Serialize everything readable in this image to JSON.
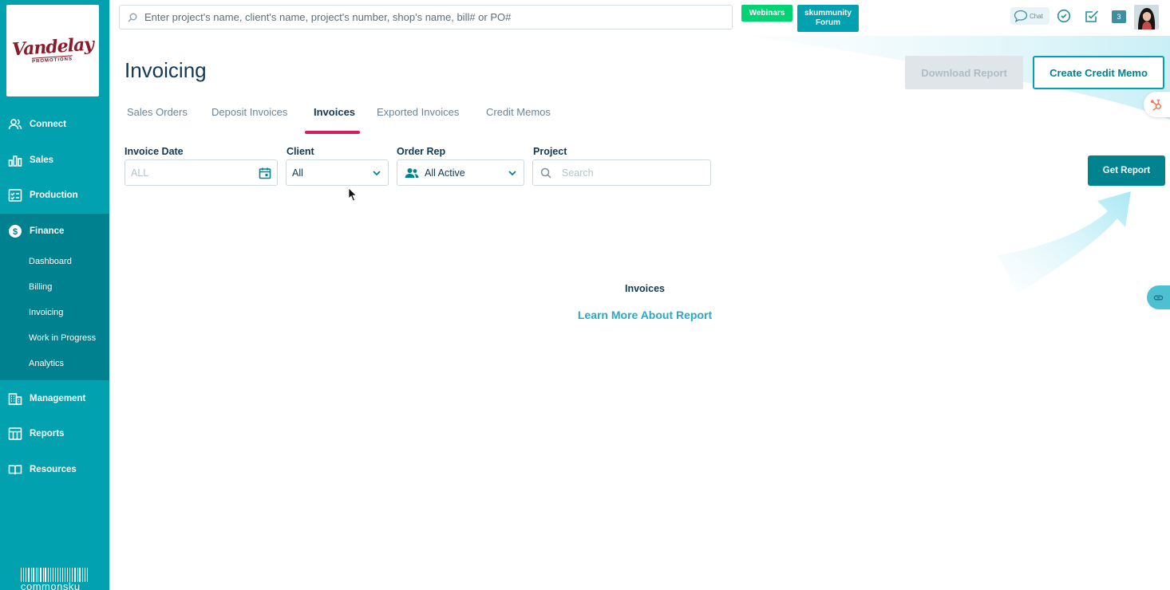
{
  "brand": {
    "logo_main": "Vandelay",
    "logo_sub": "PROMOTIONS",
    "footer_logo": "commonsku"
  },
  "topbar": {
    "search_placeholder": "Enter project's name, client's name, project's number, shop's name, bill# or PO#",
    "webinars_label": "Webinars",
    "forum_line1": "skummunity",
    "forum_line2": "Forum",
    "chat_label": "Chat",
    "notification_count": "3"
  },
  "sidebar": {
    "items": [
      {
        "label": "Connect",
        "icon": "people-icon"
      },
      {
        "label": "Sales",
        "icon": "bar-chart-icon"
      },
      {
        "label": "Production",
        "icon": "checklist-icon"
      },
      {
        "label": "Finance",
        "icon": "dollar-icon"
      },
      {
        "label": "Management",
        "icon": "building-icon"
      },
      {
        "label": "Reports",
        "icon": "table-icon"
      },
      {
        "label": "Resources",
        "icon": "book-icon"
      }
    ],
    "finance_subitems": [
      "Dashboard",
      "Billing",
      "Invoicing",
      "Work in Progress",
      "Analytics"
    ]
  },
  "page": {
    "title": "Invoicing",
    "download_label": "Download Report",
    "create_credit_label": "Create Credit Memo"
  },
  "tabs": [
    {
      "label": "Sales Orders",
      "active": false
    },
    {
      "label": "Deposit Invoices",
      "active": false
    },
    {
      "label": "Invoices",
      "active": true
    },
    {
      "label": "Exported Invoices",
      "active": false
    },
    {
      "label": "Credit Memos",
      "active": false
    }
  ],
  "filters": {
    "invoice_date": {
      "label": "Invoice Date",
      "placeholder": "ALL"
    },
    "client": {
      "label": "Client",
      "value": "All"
    },
    "order_rep": {
      "label": "Order Rep",
      "value": "All Active"
    },
    "project": {
      "label": "Project",
      "placeholder": "Search"
    },
    "get_report_label": "Get Report"
  },
  "empty_state": {
    "title": "Invoices",
    "link": "Learn More About Report"
  },
  "colors": {
    "sidebar": "#01a1b0",
    "sidebar_active": "#00818f",
    "accent": "#00838f",
    "tab_underline": "#d31e5a",
    "webinars": "#00d374",
    "link": "#2aa8c4"
  }
}
